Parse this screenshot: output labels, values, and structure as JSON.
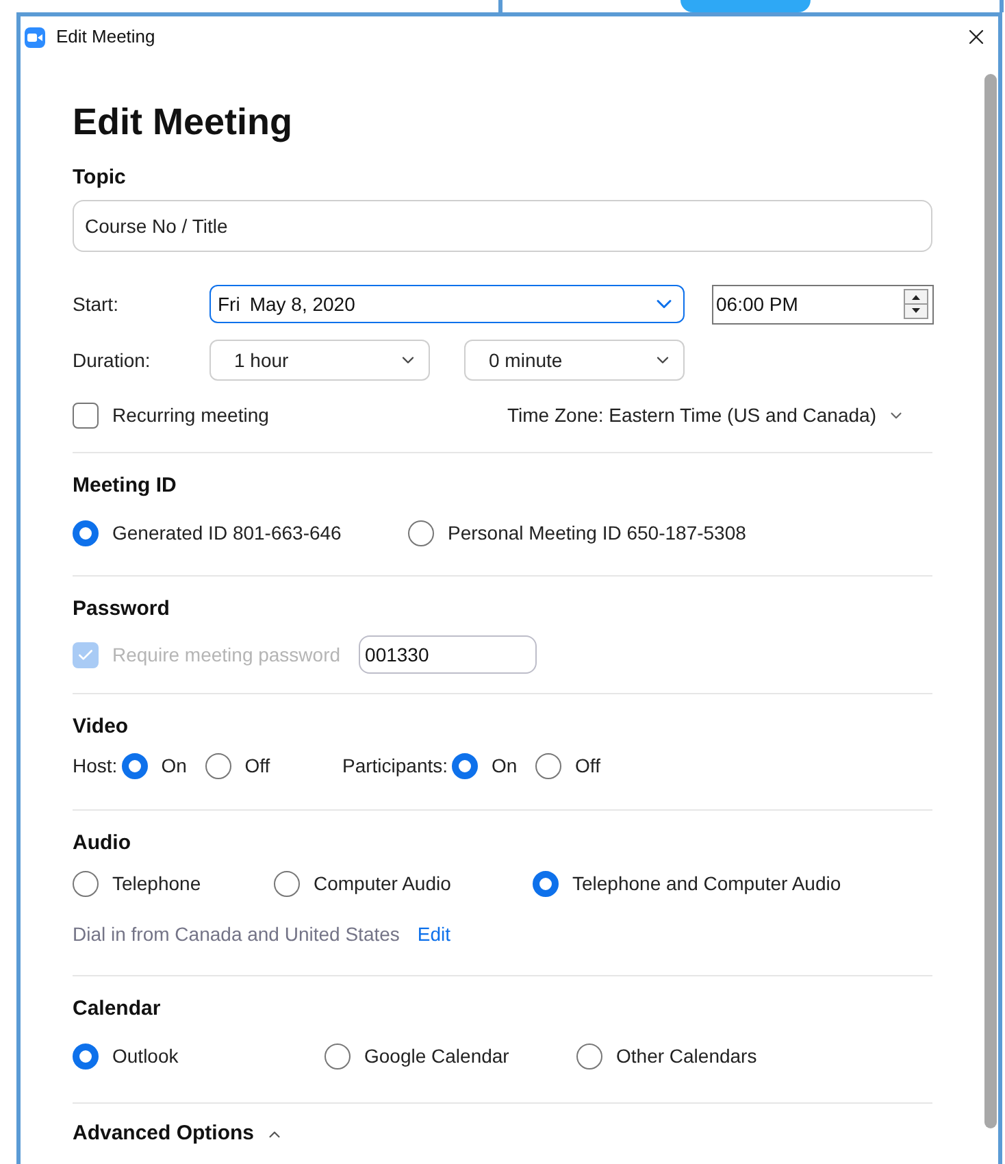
{
  "window": {
    "title": "Edit Meeting"
  },
  "heading": "Edit Meeting",
  "topic": {
    "label": "Topic",
    "value": "Course No / Title"
  },
  "start": {
    "label": "Start:",
    "day": "Fri",
    "date": "May 8, 2020",
    "time": "06:00 PM"
  },
  "duration": {
    "label": "Duration:",
    "hours": "1 hour",
    "minutes": "0 minute"
  },
  "recurring": {
    "label": "Recurring meeting",
    "checked": false
  },
  "time_zone": "Time Zone: Eastern Time (US and Canada)",
  "meeting_id": {
    "label": "Meeting ID",
    "options": [
      {
        "label": "Generated ID 801-663-646",
        "selected": true
      },
      {
        "label": "Personal Meeting ID 650-187-5308",
        "selected": false
      }
    ]
  },
  "password": {
    "label": "Password",
    "require_label": "Require meeting password",
    "checked": true,
    "disabled": true,
    "value": "001330"
  },
  "video": {
    "label": "Video",
    "groups": [
      {
        "label": "Host:",
        "options": [
          {
            "label": "On",
            "selected": true
          },
          {
            "label": "Off",
            "selected": false
          }
        ]
      },
      {
        "label": "Participants:",
        "options": [
          {
            "label": "On",
            "selected": true
          },
          {
            "label": "Off",
            "selected": false
          }
        ]
      }
    ]
  },
  "audio": {
    "label": "Audio",
    "options": [
      {
        "label": "Telephone",
        "selected": false
      },
      {
        "label": "Computer Audio",
        "selected": false
      },
      {
        "label": "Telephone and Computer Audio",
        "selected": true
      }
    ],
    "dial_in": "Dial in from Canada and United States",
    "edit_link": "Edit"
  },
  "calendar": {
    "label": "Calendar",
    "options": [
      {
        "label": "Outlook",
        "selected": true
      },
      {
        "label": "Google Calendar",
        "selected": false
      },
      {
        "label": "Other Calendars",
        "selected": false
      }
    ]
  },
  "advanced_options": {
    "label": "Advanced Options"
  }
}
